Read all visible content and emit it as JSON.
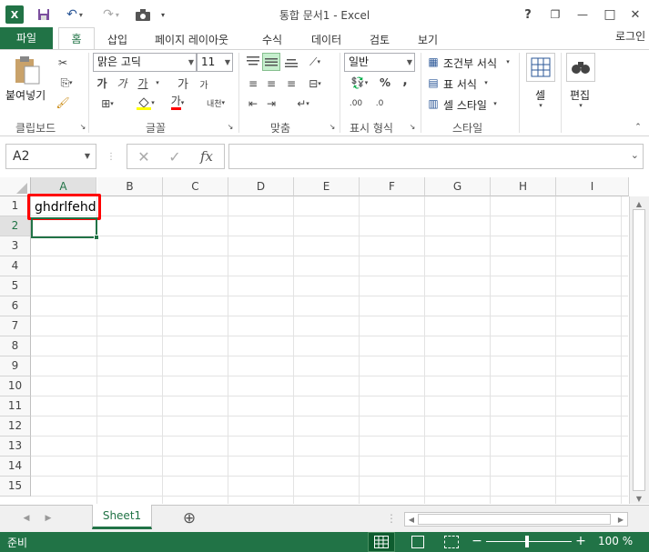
{
  "window": {
    "title": "통합 문서1 - Excel",
    "help": "?",
    "minimize": "—",
    "restore": "❐",
    "close": "✕"
  },
  "quick_access": {
    "app_icon": "excel-icon",
    "save": "save-icon",
    "undo": "undo-icon",
    "redo": "redo-icon",
    "camera": "camera-icon"
  },
  "tabs": {
    "file": "파일",
    "home": "홈",
    "insert": "삽입",
    "layout": "페이지 레이아웃",
    "formulas": "수식",
    "data": "데이터",
    "review": "검토",
    "view": "보기",
    "login": "로그인"
  },
  "ribbon": {
    "clipboard": {
      "paste": "붙여넣기",
      "label": "클립보드"
    },
    "font": {
      "name": "맑은 고딕",
      "size": "11",
      "bold": "가",
      "italic": "가",
      "underline": "가",
      "grow": "가",
      "shrink": "가",
      "font_color": "가",
      "phonetic": "내천",
      "label": "글꼴"
    },
    "alignment": {
      "label": "맞춤"
    },
    "number": {
      "format": "일반",
      "percent": "%",
      "comma": ",",
      "label": "표시 형식"
    },
    "styles": {
      "conditional": "조건부 서식",
      "table": "표 서식",
      "cell_style": "셀 스타일",
      "label": "스타일"
    },
    "cells": {
      "label": "셀"
    },
    "editing": {
      "label": "편집"
    }
  },
  "formula_bar": {
    "name_box": "A2",
    "fx": "fx",
    "cancel": "✕",
    "enter": "✓",
    "content": ""
  },
  "columns": [
    "A",
    "B",
    "C",
    "D",
    "E",
    "F",
    "G",
    "H",
    "I"
  ],
  "rows": [
    "1",
    "2",
    "3",
    "4",
    "5",
    "6",
    "7",
    "8",
    "9",
    "10",
    "11",
    "12",
    "13",
    "14",
    "15"
  ],
  "cells": {
    "A1": "ghdrlfehd"
  },
  "sheet": {
    "tab": "Sheet1",
    "add": "⊕"
  },
  "status": {
    "ready": "준비",
    "zoom": "100 %",
    "zoom_out": "−",
    "zoom_in": "+"
  },
  "colors": {
    "accent": "#217346",
    "highlight": "#ff0000"
  }
}
